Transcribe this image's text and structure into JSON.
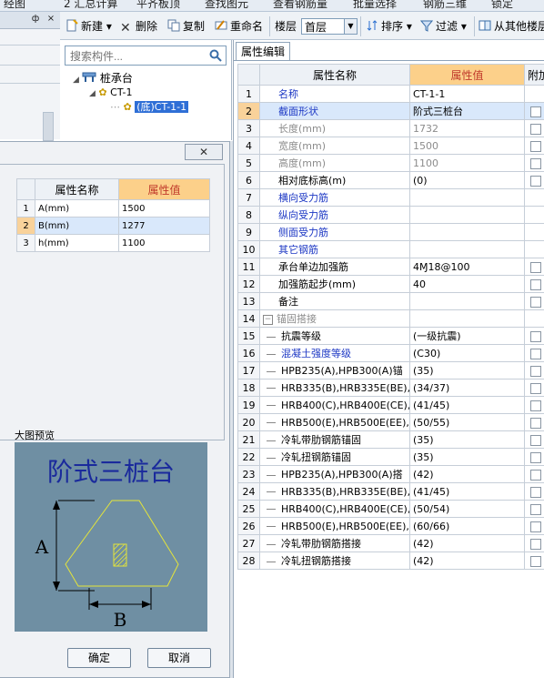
{
  "top_strip": {
    "items": [
      "经图",
      "2 汇总计算",
      "平齐板顶",
      "查找图元",
      "查看钢筋量",
      "批量选择",
      "钢筋三维",
      "锁定"
    ]
  },
  "left_strip": {
    "pin": "ф",
    "close": "×"
  },
  "toolbar": {
    "new_label": "新建",
    "delete_label": "删除",
    "copy_label": "复制",
    "rename_label": "重命名",
    "floor_label": "楼层",
    "floor_value": "首层",
    "sort_label": "排序",
    "filter_label": "过滤",
    "copy_from_label": "从其他楼层"
  },
  "tree": {
    "search_placeholder": "搜索构件...",
    "root": "桩承台",
    "child": "CT-1",
    "leaf": "(底)CT-1-1"
  },
  "prop_panel": {
    "tab": "属性编辑",
    "headers": {
      "name": "属性名称",
      "value": "属性值",
      "extra": "附加"
    },
    "rows": [
      {
        "n": "1",
        "name": "名称",
        "value": "CT-1-1",
        "style": "blue",
        "cb": false
      },
      {
        "n": "2",
        "name": "截面形状",
        "value": "阶式三桩台",
        "style": "blue",
        "cb": true,
        "sel": true
      },
      {
        "n": "3",
        "name": "长度(mm)",
        "value": "1732",
        "style": "gray",
        "cb": true
      },
      {
        "n": "4",
        "name": "宽度(mm)",
        "value": "1500",
        "style": "gray",
        "cb": true
      },
      {
        "n": "5",
        "name": "高度(mm)",
        "value": "1100",
        "style": "gray",
        "cb": true
      },
      {
        "n": "6",
        "name": "相对底标高(m)",
        "value": "(0)",
        "style": "",
        "cb": true
      },
      {
        "n": "7",
        "name": "横向受力筋",
        "value": "",
        "style": "blue",
        "cb": false
      },
      {
        "n": "8",
        "name": "纵向受力筋",
        "value": "",
        "style": "blue",
        "cb": false
      },
      {
        "n": "9",
        "name": "侧面受力筋",
        "value": "",
        "style": "blue",
        "cb": false
      },
      {
        "n": "10",
        "name": "其它钢筋",
        "value": "",
        "style": "blue",
        "cb": false
      },
      {
        "n": "11",
        "name": "承台单边加强筋",
        "value": "4Ɱ18@100",
        "style": "",
        "cb": true
      },
      {
        "n": "12",
        "name": "加强筋起步(mm)",
        "value": "40",
        "style": "",
        "cb": true
      },
      {
        "n": "13",
        "name": "备注",
        "value": "",
        "style": "",
        "cb": true
      },
      {
        "n": "14",
        "name": "锚固搭接",
        "value": "",
        "style": "gray",
        "cb": false,
        "group": true
      },
      {
        "n": "15",
        "name": "抗震等级",
        "value": "(一级抗震)",
        "style": "",
        "cb": true,
        "indent": true
      },
      {
        "n": "16",
        "name": "混凝土强度等级",
        "value": "(C30)",
        "style": "blue",
        "cb": true,
        "indent": true
      },
      {
        "n": "17",
        "name": "HPB235(A),HPB300(A)锚",
        "value": "(35)",
        "style": "",
        "cb": true,
        "indent": true
      },
      {
        "n": "18",
        "name": "HRB335(B),HRB335E(BE),",
        "value": "(34/37)",
        "style": "",
        "cb": true,
        "indent": true
      },
      {
        "n": "19",
        "name": "HRB400(C),HRB400E(CE),",
        "value": "(41/45)",
        "style": "",
        "cb": true,
        "indent": true
      },
      {
        "n": "20",
        "name": "HRB500(E),HRB500E(EE),",
        "value": "(50/55)",
        "style": "",
        "cb": true,
        "indent": true
      },
      {
        "n": "21",
        "name": "冷轧带肋钢筋锚固",
        "value": "(35)",
        "style": "",
        "cb": true,
        "indent": true
      },
      {
        "n": "22",
        "name": "冷轧扭钢筋锚固",
        "value": "(35)",
        "style": "",
        "cb": true,
        "indent": true
      },
      {
        "n": "23",
        "name": "HPB235(A),HPB300(A)搭",
        "value": "(42)",
        "style": "",
        "cb": true,
        "indent": true
      },
      {
        "n": "24",
        "name": "HRB335(B),HRB335E(BE),",
        "value": "(41/45)",
        "style": "",
        "cb": true,
        "indent": true
      },
      {
        "n": "25",
        "name": "HRB400(C),HRB400E(CE),",
        "value": "(50/54)",
        "style": "",
        "cb": true,
        "indent": true
      },
      {
        "n": "26",
        "name": "HRB500(E),HRB500E(EE),",
        "value": "(60/66)",
        "style": "",
        "cb": true,
        "indent": true
      },
      {
        "n": "27",
        "name": "冷轧带肋钢筋搭接",
        "value": "(42)",
        "style": "",
        "cb": true,
        "indent": true
      },
      {
        "n": "28",
        "name": "冷轧扭钢筋搭接",
        "value": "(42)",
        "style": "",
        "cb": true,
        "indent": true
      }
    ]
  },
  "dialog": {
    "close_label": "✕",
    "headers": {
      "name": "属性名称",
      "value": "属性值"
    },
    "rows": [
      {
        "n": "1",
        "name": "A(mm)",
        "value": "1500"
      },
      {
        "n": "2",
        "name": "B(mm)",
        "value": "1277",
        "sel": true
      },
      {
        "n": "3",
        "name": "h(mm)",
        "value": "1100"
      }
    ],
    "preview_label": "大图预览",
    "preview_title": "阶式三桩台",
    "dim_a": "A",
    "dim_b": "B",
    "ok_label": "确定",
    "cancel_label": "取消"
  },
  "colors": {
    "accent_header": "#fcd08a",
    "selection": "#d9e8fb",
    "link_blue": "#1c37c4",
    "preview_bg": "#6f8fa3",
    "shape_line": "#e5e53a"
  }
}
